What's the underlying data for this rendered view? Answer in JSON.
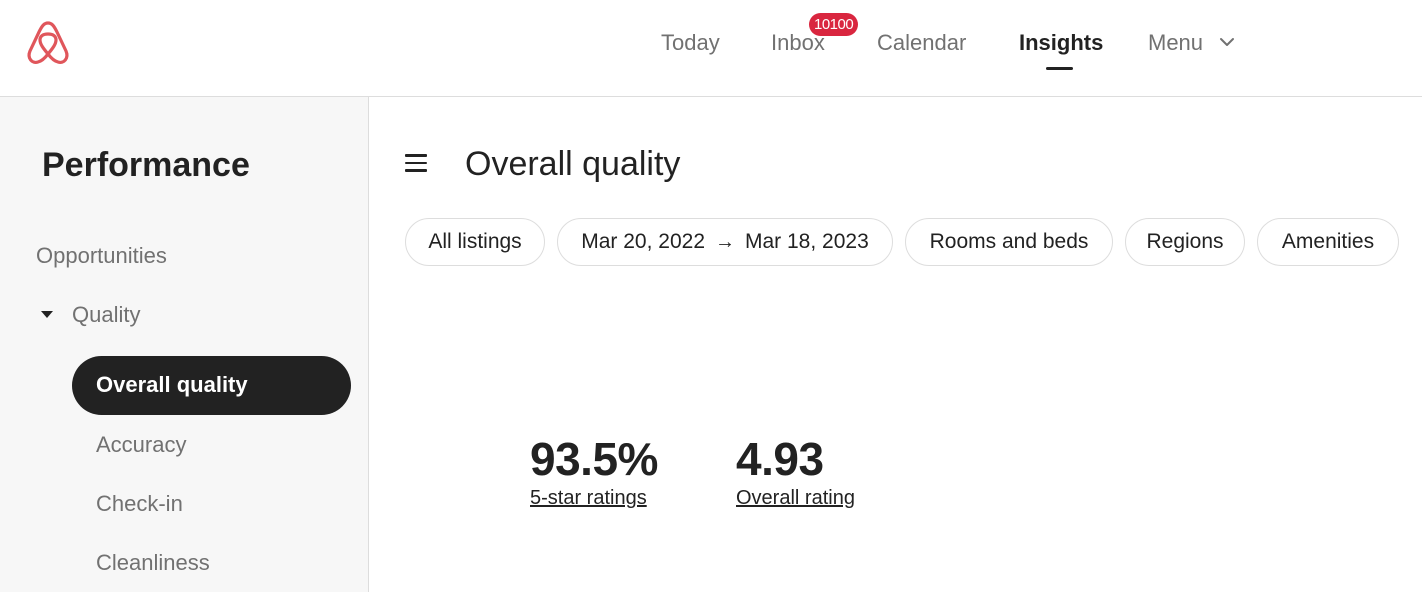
{
  "header": {
    "logo_icon": "airbnb-logo-icon",
    "nav": [
      {
        "label": "Today"
      },
      {
        "label": "Inbox",
        "badge": "10100"
      },
      {
        "label": "Calendar"
      },
      {
        "label": "Insights"
      },
      {
        "label": "Menu",
        "icon": "chevron-down-icon"
      }
    ],
    "active": "Insights",
    "accent_color": "#d9263f"
  },
  "sidebar": {
    "title": "Performance",
    "items": [
      {
        "label": "Opportunities"
      },
      {
        "label": "Quality",
        "icon": "caret-down-icon"
      },
      {
        "label": "Overall quality"
      },
      {
        "label": "Accuracy"
      },
      {
        "label": "Check-in"
      },
      {
        "label": "Cleanliness"
      }
    ],
    "active": "Overall quality"
  },
  "main": {
    "title": "Overall quality",
    "filters": {
      "listings": "All listings",
      "date_start": "Mar 20, 2022",
      "date_arrow": "→",
      "date_end": "Mar 18, 2023",
      "rooms": "Rooms and beds",
      "regions": "Regions",
      "amenities": "Amenities"
    },
    "stats": [
      {
        "value": "93.5%",
        "label": "5-star ratings"
      },
      {
        "value": "4.93",
        "label": "Overall rating"
      }
    ]
  }
}
